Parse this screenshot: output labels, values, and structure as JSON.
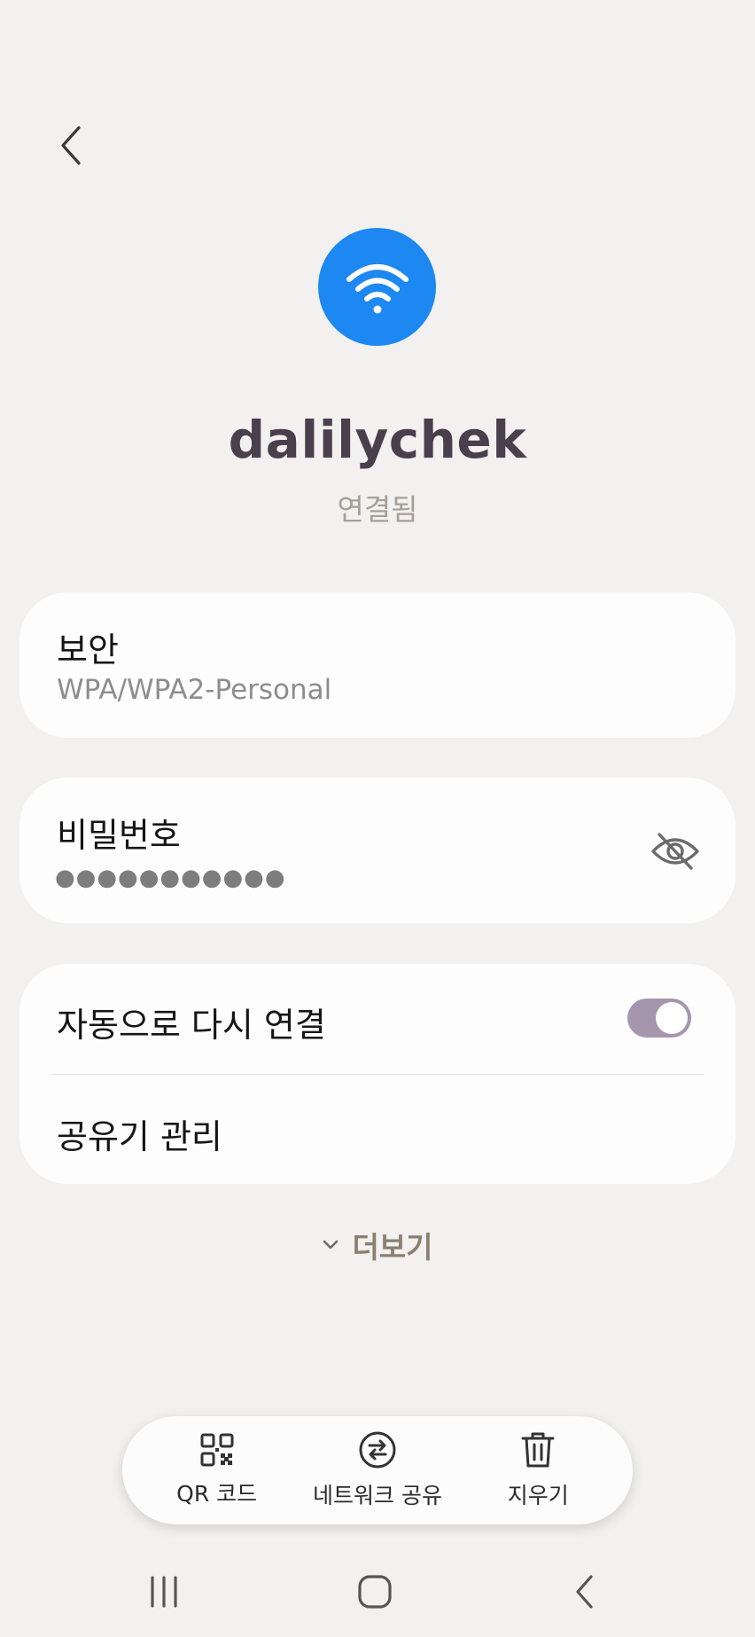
{
  "header": {
    "back_icon": "chevron-left-icon"
  },
  "network": {
    "icon": "wifi-icon",
    "accent_color": "#1e88f2",
    "name": "dalilychek",
    "status": "연결됨"
  },
  "security": {
    "title": "보안",
    "value": "WPA/WPA2-Personal"
  },
  "password": {
    "title": "비밀번호",
    "masked_value": "●●●●●●●●●●●",
    "visibility_icon": "eye-off-icon"
  },
  "auto_reconnect": {
    "title": "자동으로 다시 연결",
    "enabled": true,
    "toggle_color": "#a596ae"
  },
  "router_manage": {
    "title": "공유기 관리"
  },
  "more": {
    "label": "더보기",
    "icon": "chevron-down-icon"
  },
  "actions": [
    {
      "label": "QR 코드",
      "icon": "qr-code-icon"
    },
    {
      "label": "네트워크 공유",
      "icon": "share-network-icon"
    },
    {
      "label": "지우기",
      "icon": "trash-icon"
    }
  ],
  "navbar": {
    "recents_icon": "recents-icon",
    "home_icon": "home-icon",
    "back_icon": "back-icon"
  }
}
